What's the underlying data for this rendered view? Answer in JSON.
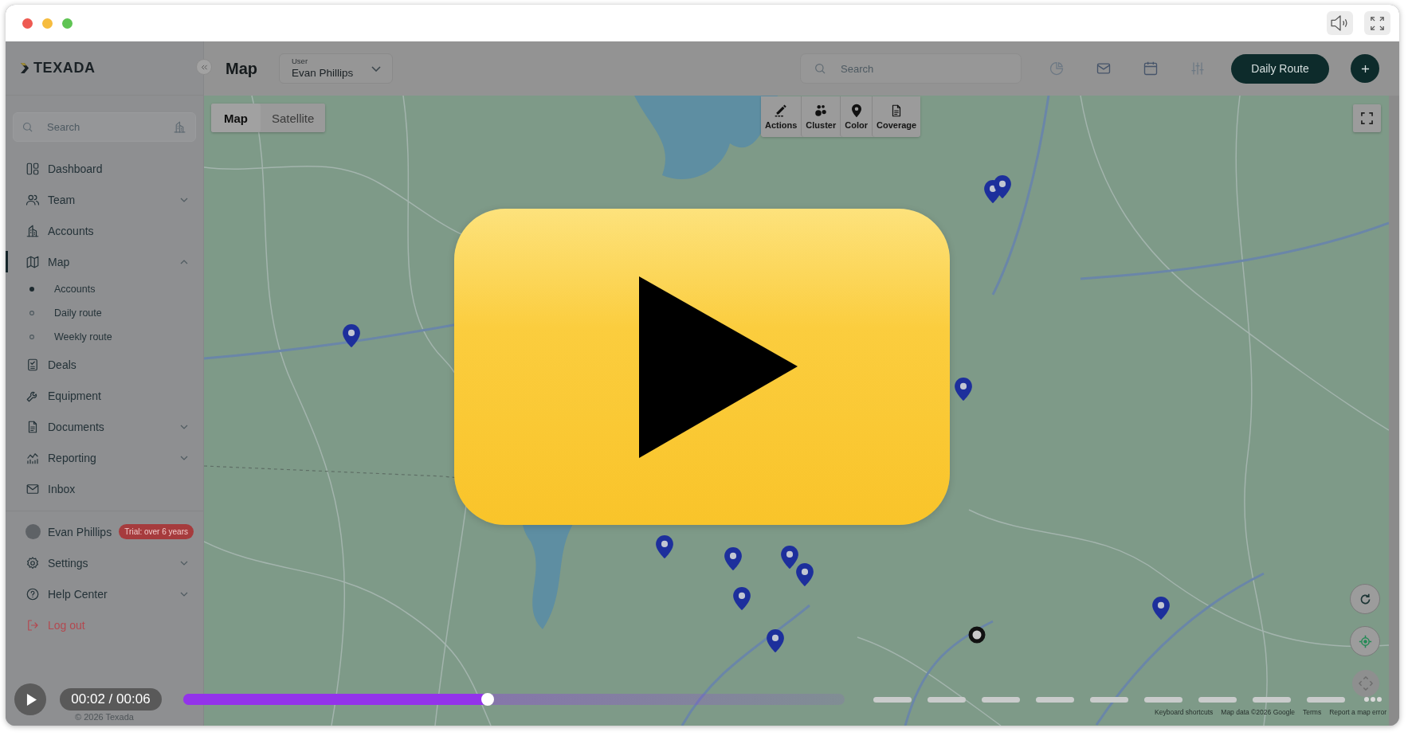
{
  "sidebar": {
    "logo": "TEXADA",
    "search": {
      "placeholder": "Search"
    },
    "items": [
      {
        "label": "Dashboard",
        "kind": "link",
        "selected": false
      },
      {
        "label": "Team",
        "kind": "group",
        "selected": false,
        "expanded": false
      },
      {
        "label": "Accounts",
        "kind": "link",
        "selected": false
      },
      {
        "label": "Map",
        "kind": "group",
        "selected": true,
        "expanded": true,
        "children": [
          {
            "label": "Accounts",
            "selected": true
          },
          {
            "label": "Daily route",
            "selected": false
          },
          {
            "label": "Weekly route",
            "selected": false
          }
        ]
      },
      {
        "label": "Deals",
        "kind": "link",
        "selected": false
      },
      {
        "label": "Equipment",
        "kind": "link",
        "selected": false
      },
      {
        "label": "Documents",
        "kind": "group",
        "selected": false,
        "expanded": false
      },
      {
        "label": "Reporting",
        "kind": "group",
        "selected": false,
        "expanded": false
      },
      {
        "label": "Inbox",
        "kind": "link",
        "selected": false
      }
    ],
    "user": {
      "name": "Evan Phillips",
      "badge": "Trial: over 6 years"
    },
    "footer_items": [
      {
        "label": "Settings",
        "kind": "group",
        "selected": false,
        "expanded": false
      },
      {
        "label": "Help Center",
        "kind": "group",
        "selected": false,
        "expanded": false
      },
      {
        "label": "Log out",
        "kind": "logout",
        "selected": false
      }
    ],
    "copyright": "© 2026 Texada"
  },
  "topbar": {
    "title": "Map",
    "user_select": {
      "label": "User",
      "value": "Evan Phillips"
    },
    "search": {
      "placeholder": "Search"
    },
    "primary_button": "Daily Route"
  },
  "map": {
    "view_toggle": [
      {
        "label": "Map",
        "selected": true
      },
      {
        "label": "Satellite",
        "selected": false
      }
    ],
    "tools": [
      {
        "label": "Actions"
      },
      {
        "label": "Cluster"
      },
      {
        "label": "Color"
      },
      {
        "label": "Coverage"
      }
    ],
    "attribution": [
      "Keyboard shortcuts",
      "Map data ©2026 Google",
      "Terms",
      "Report a map error"
    ]
  },
  "player": {
    "playing": false,
    "time": "00:02 / 00:06",
    "level": 0.46
  }
}
